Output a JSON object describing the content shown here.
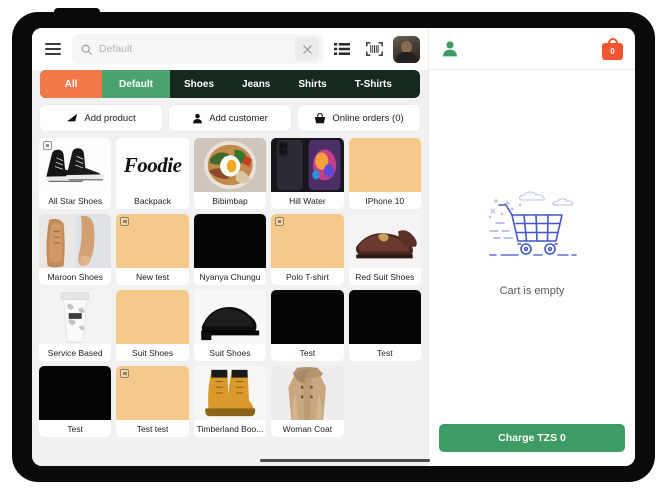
{
  "topbar": {
    "menu_icon": "hamburger-menu-icon",
    "search_icon": "search-icon",
    "search_value": "",
    "search_placeholder": "Default",
    "clear_icon": "close-x-icon",
    "list_view_icon": "list-view-icon",
    "barcode_icon": "barcode-scan-icon",
    "avatar_alt": "user-avatar"
  },
  "tabs": [
    {
      "label": "All",
      "active": true,
      "style": "all"
    },
    {
      "label": "Default",
      "active": false,
      "style": "default"
    },
    {
      "label": "Shoes",
      "active": false,
      "style": "plain"
    },
    {
      "label": "Jeans",
      "active": false,
      "style": "plain"
    },
    {
      "label": "Shirts",
      "active": false,
      "style": "plain"
    },
    {
      "label": "T-Shirts",
      "active": false,
      "style": "plain"
    }
  ],
  "actions": [
    {
      "label": "Add product",
      "icon": "add-product-icon"
    },
    {
      "label": "Add customer",
      "icon": "person-icon"
    },
    {
      "label": "Online orders (0)",
      "icon": "basket-icon"
    }
  ],
  "products": [
    {
      "name": "All Star Shoes",
      "thumb": "sneakers",
      "badge": true
    },
    {
      "name": "Backpack",
      "thumb": "foodie-logo",
      "badge": false
    },
    {
      "name": "Bibimbap",
      "thumb": "bibimbap-bowl",
      "badge": false
    },
    {
      "name": "Hill Water",
      "thumb": "smartphone",
      "badge": false
    },
    {
      "name": "IPhone 10",
      "thumb": "placeholder-tan",
      "badge": false
    },
    {
      "name": "Maroon Shoes",
      "thumb": "tan-dress-shoe",
      "badge": false
    },
    {
      "name": "New test",
      "thumb": "placeholder-tan",
      "badge": true
    },
    {
      "name": "Nyanya Chungu",
      "thumb": "black",
      "badge": false
    },
    {
      "name": "Polo T-shirt",
      "thumb": "placeholder-tan",
      "badge": true
    },
    {
      "name": "Red Suit Shoes",
      "thumb": "brown-loafer",
      "badge": false
    },
    {
      "name": "Service Based",
      "thumb": "coffee-cup",
      "badge": false
    },
    {
      "name": "Suit Shoes",
      "thumb": "placeholder-tan",
      "badge": false
    },
    {
      "name": "Suit Shoes",
      "thumb": "black-dress-shoe",
      "badge": false
    },
    {
      "name": "Test",
      "thumb": "black",
      "badge": false
    },
    {
      "name": "Test",
      "thumb": "black",
      "badge": false
    },
    {
      "name": "Test",
      "thumb": "black",
      "badge": false
    },
    {
      "name": "Test test",
      "thumb": "placeholder-tan",
      "badge": true
    },
    {
      "name": "Timberland Boo...",
      "thumb": "timberland-boots",
      "badge": false
    },
    {
      "name": "Woman Coat",
      "thumb": "trench-coat",
      "badge": false
    }
  ],
  "cart": {
    "customer_icon": "person-icon",
    "bag_icon": "shopping-bag-icon",
    "bag_count": "0",
    "empty_illustration": "empty-cart-illustration",
    "empty_text": "Cart is empty",
    "charge_label": "Charge TZS 0"
  },
  "colors": {
    "accent_orange": "#f4784a",
    "accent_green": "#4aa36d",
    "tab_dark": "#16291f",
    "charge_green": "#3d9b63",
    "bag_red": "#f2552f",
    "placeholder_tan": "#f4c989",
    "illustration_blue": "#4456c8"
  }
}
